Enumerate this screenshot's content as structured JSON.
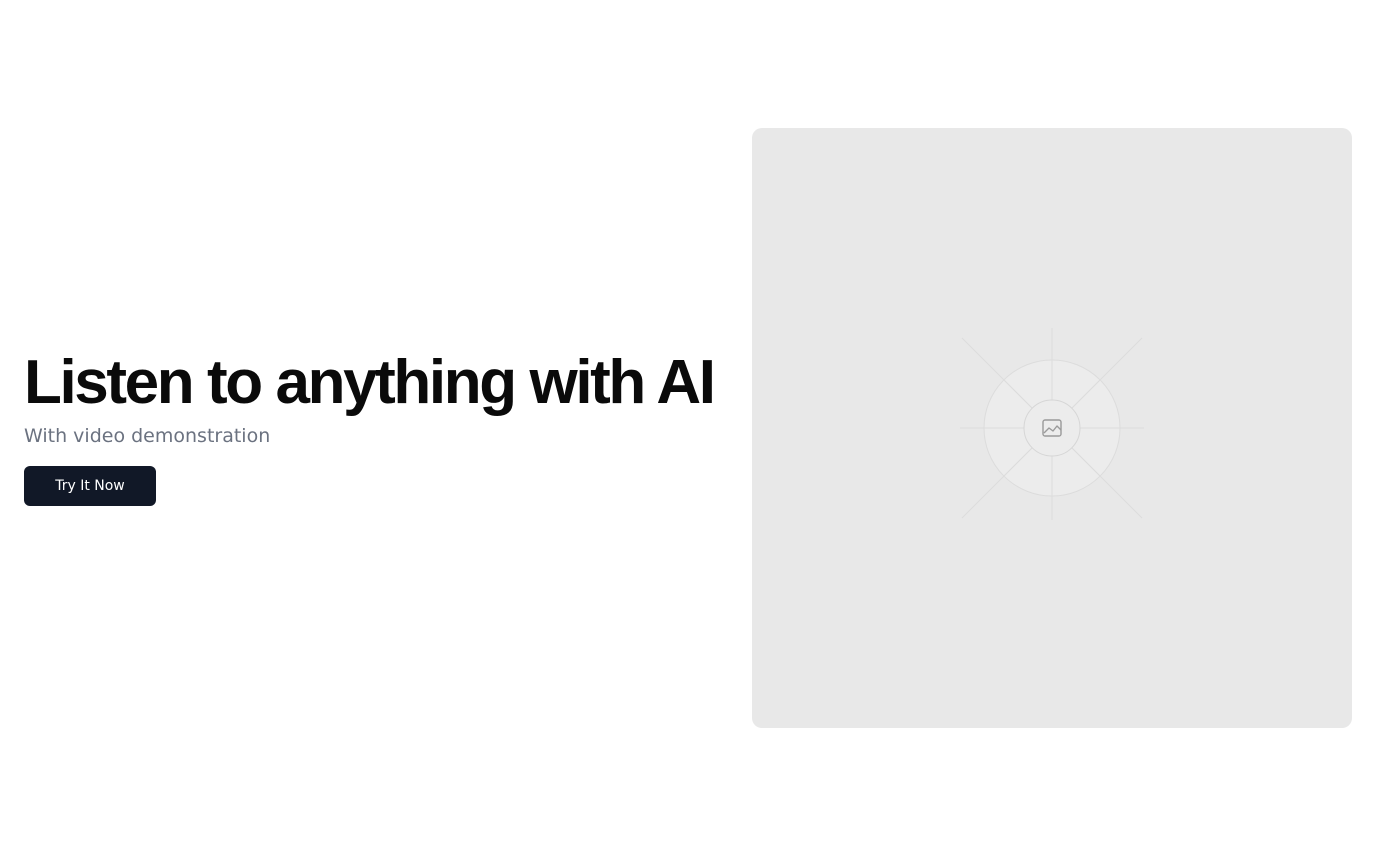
{
  "hero": {
    "headline": "Listen to anything with AI",
    "subtitle": "With video demonstration",
    "cta_label": "Try It Now"
  },
  "media": {
    "icon": "image-placeholder-icon"
  },
  "colors": {
    "background": "#ffffff",
    "headline": "#0a0a0a",
    "subtitle": "#6b7280",
    "button_bg": "#111827",
    "button_text": "#ffffff",
    "media_bg": "#e8e8e8"
  }
}
